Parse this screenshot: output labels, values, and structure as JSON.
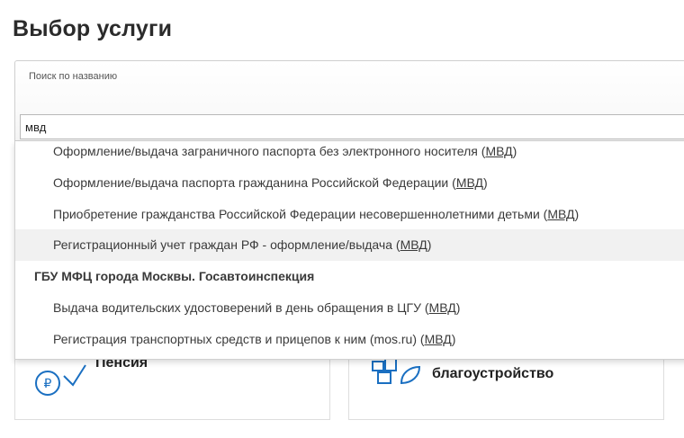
{
  "page": {
    "title": "Выбор услуги"
  },
  "search": {
    "label": "Поиск по названию",
    "value": "мвд"
  },
  "dropdown": {
    "items": [
      {
        "type": "item",
        "text": "Оформление/выдача заграничного паспорта без электронного носителя",
        "agency": "МВД",
        "highlighted": false
      },
      {
        "type": "item",
        "text": "Оформление/выдача паспорта гражданина Российской Федерации",
        "agency": "МВД",
        "highlighted": false
      },
      {
        "type": "item",
        "text": "Приобретение гражданства Российской Федерации несовершеннолетними детьми",
        "agency": "МВД",
        "highlighted": false
      },
      {
        "type": "item",
        "text": "Регистрационный учет граждан РФ - оформление/выдача",
        "agency": "МВД",
        "highlighted": true
      },
      {
        "type": "group",
        "text": "ГБУ МФЦ города Москвы. Госавтоинспекция"
      },
      {
        "type": "item",
        "text": "Выдача водительских удостоверений в день обращения в ЦГУ",
        "agency": "МВД",
        "highlighted": false
      },
      {
        "type": "item",
        "text": "Регистрация транспортных средств и прицепов к ним (mos.ru)",
        "agency": "МВД",
        "highlighted": false
      }
    ]
  },
  "cards": {
    "left": {
      "title": "Пенсия",
      "icon": "ruble-coin-icon"
    },
    "right": {
      "title": "благоустройство",
      "icon": "city-blocks-icon"
    }
  },
  "colors": {
    "icon_blue": "#1a6fc1",
    "highlight_bg": "#f1f1f1"
  }
}
